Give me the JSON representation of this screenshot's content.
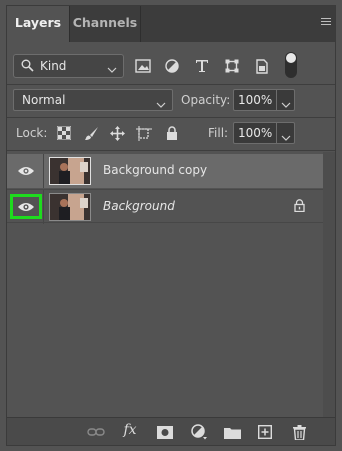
{
  "tabs": [
    {
      "label": "Layers",
      "active": true
    },
    {
      "label": "Channels",
      "active": false
    }
  ],
  "filter": {
    "kind_label": "Kind",
    "icons": [
      "image-filter-icon",
      "adjustment-filter-icon",
      "type-filter-icon",
      "shape-filter-icon",
      "smart-object-filter-icon"
    ]
  },
  "blend": {
    "mode": "Normal",
    "opacity_label": "Opacity:",
    "opacity_value": "100%"
  },
  "lock": {
    "label": "Lock:",
    "fill_label": "Fill:",
    "fill_value": "100%"
  },
  "layers": [
    {
      "name": "Background copy",
      "selected": true,
      "visible": true,
      "italic": false,
      "locked": false
    },
    {
      "name": "Background",
      "selected": false,
      "visible": true,
      "italic": true,
      "locked": true
    }
  ],
  "bottom_icons": [
    "link-icon",
    "fx-icon",
    "mask-icon",
    "adjustment-icon",
    "folder-icon",
    "new-layer-icon",
    "trash-icon"
  ],
  "fx_label": "fx",
  "colors": {
    "panel_bg": "#535353",
    "selected_row": "#6a6a6a",
    "highlight": "#1edc1e"
  }
}
